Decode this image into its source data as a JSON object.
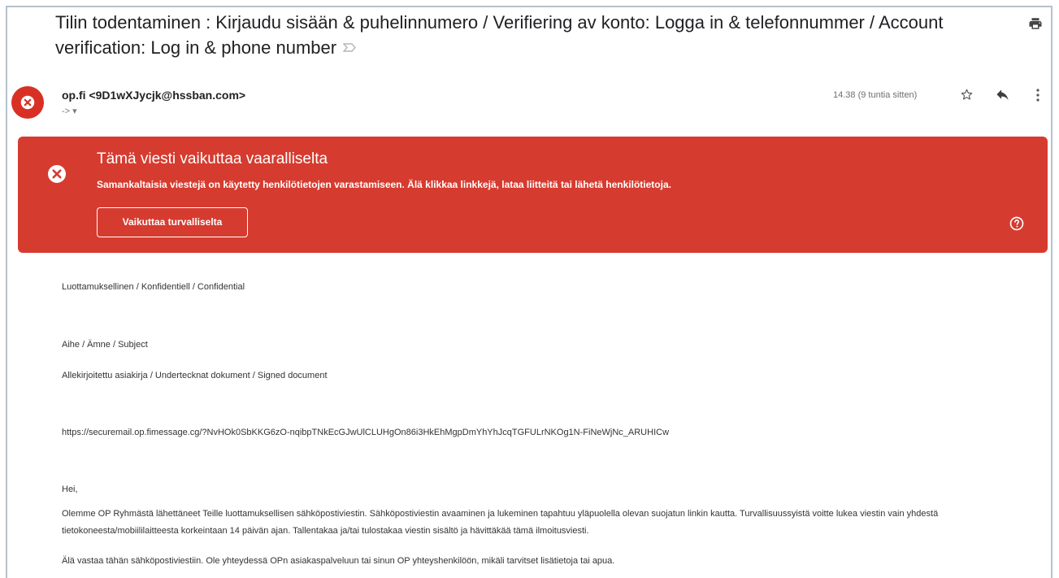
{
  "email": {
    "subject": "Tilin todentaminen : Kirjaudu sisään & puhelinnumero / Verifiering av konto: Logga in & telefonnummer / Account verification: Log in & phone number",
    "sender": {
      "name": "op.fi",
      "email": "<9D1wXJycjk@hssban.com>"
    },
    "to_label": "-> ▾",
    "time": "14.38 (9 tuntia sitten)"
  },
  "warning": {
    "title": "Tämä viesti vaikuttaa vaaralliselta",
    "description": "Samankaltaisia viestejä on käytetty henkilötietojen varastamiseen. Älä klikkaa linkkejä, lataa liitteitä tai lähetä henkilötietoja.",
    "button_label": "Vaikuttaa turvalliselta",
    "color": "#d63b2f"
  },
  "body": {
    "confidential": "Luottamuksellinen / Konfidentiell / Confidential",
    "subject_label": "Aihe / Ämne / Subject",
    "document_label": "Allekirjoitettu asiakirja / Undertecknat dokument / Signed document",
    "link": "https://securemail.op.fimessage.cg/?NvHOk0SbKKG6zO-nqibpTNkEcGJwUlCLUHgOn86i3HkEhMgpDmYhYhJcqTGFULrNKOg1N-FiNeWjNc_ARUHICw",
    "greeting": "Hei,",
    "paragraph1": "Olemme OP Ryhmästä lähettäneet Teille luottamuksellisen sähköpostiviestin. Sähköpostiviestin avaaminen ja lukeminen tapahtuu yläpuolella olevan suojatun linkin kautta. Turvallisuussyistä voitte lukea viestin vain yhdestä tietokoneesta/mobiililaitteesta korkeintaan 14 päivän ajan. Tallentakaa ja/tai tulostakaa viestin sisältö ja hävittäkää tämä ilmoitusviesti.",
    "paragraph2": "Älä vastaa tähän sähköpostiviestiin. Ole yhteydessä OPn asiakaspalveluun tai sinun OP yhteyshenkilöön, mikäli tarvitset lisätietoja tai apua."
  },
  "icons": {
    "avatar": "alert-circle-icon",
    "important": "important-marker-icon",
    "print": "print-icon",
    "star": "star-icon",
    "reply": "reply-icon",
    "more": "more-vertical-icon",
    "warning": "error-circle-icon",
    "help": "help-icon"
  }
}
